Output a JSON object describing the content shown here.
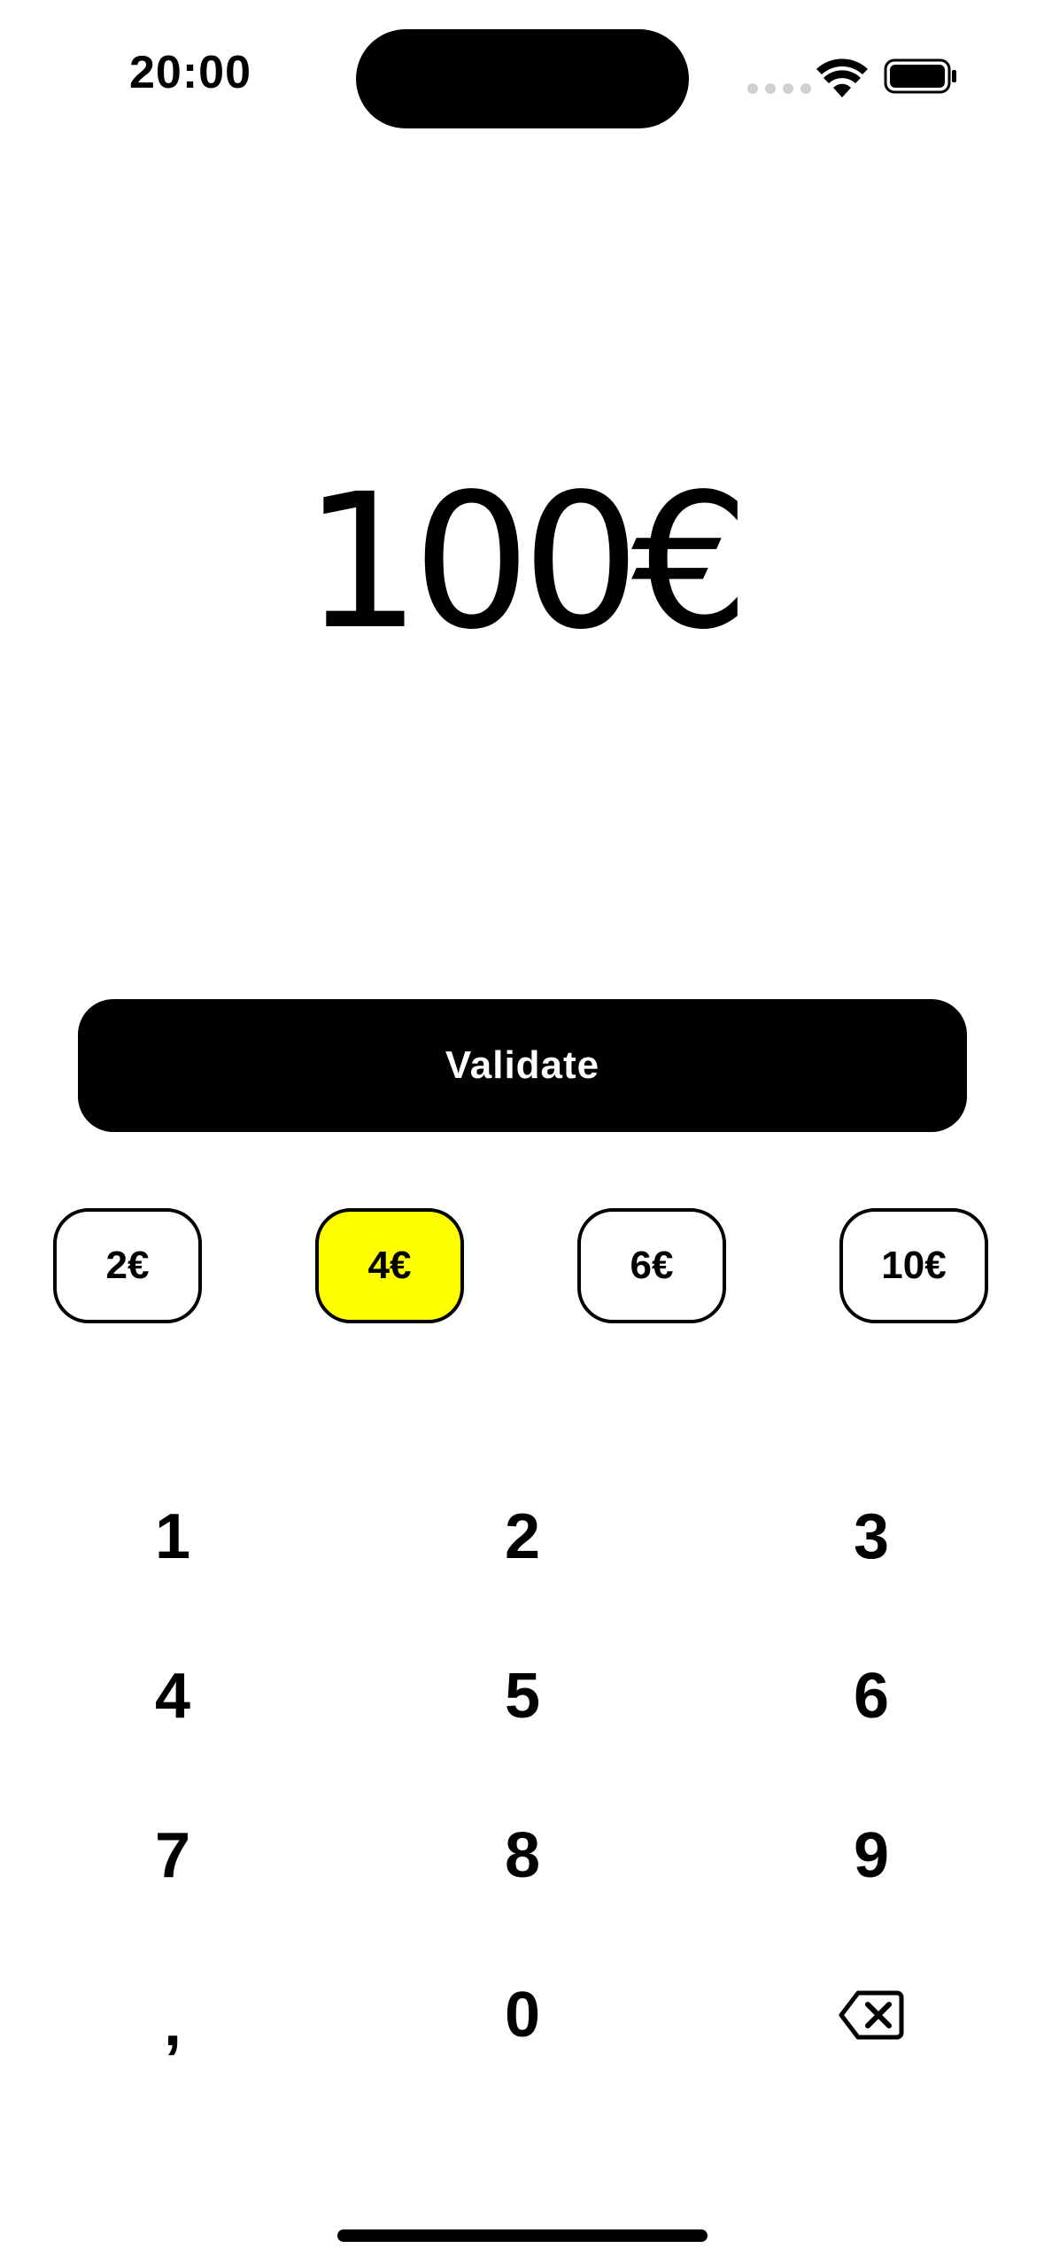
{
  "status_bar": {
    "time": "20:00"
  },
  "amount": {
    "display": "100€"
  },
  "validate": {
    "label": "Validate"
  },
  "tips": [
    {
      "label": "2€",
      "selected": false
    },
    {
      "label": "4€",
      "selected": true
    },
    {
      "label": "6€",
      "selected": false
    },
    {
      "label": "10€",
      "selected": false
    }
  ],
  "keypad": {
    "keys": [
      "1",
      "2",
      "3",
      "4",
      "5",
      "6",
      "7",
      "8",
      "9",
      ",",
      "0"
    ],
    "backspace_icon": "backspace-icon"
  },
  "colors": {
    "selected_tip": "#ffff00",
    "primary": "#000000",
    "background": "#ffffff"
  }
}
